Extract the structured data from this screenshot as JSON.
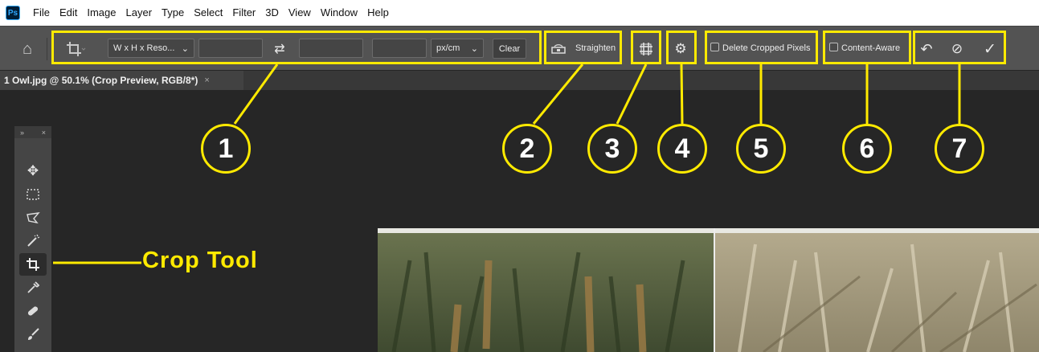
{
  "app": {
    "logo": "Ps",
    "menu": [
      "File",
      "Edit",
      "Image",
      "Layer",
      "Type",
      "Select",
      "Filter",
      "3D",
      "View",
      "Window",
      "Help"
    ]
  },
  "options": {
    "home_icon": "home-icon",
    "crop_icon": "crop-icon",
    "ratio_preset": "W x H x Reso...",
    "width_value": "",
    "swap_icon": "swap-arrows-icon",
    "height_value": "",
    "resolution_value": "",
    "resolution_unit": "px/cm",
    "clear_label": "Clear",
    "straighten_label": "Straighten",
    "overlay_icon": "grid-overlay-icon",
    "settings_icon": "gear-icon",
    "delete_cropped_label": "Delete Cropped Pixels",
    "content_aware_label": "Content-Aware",
    "reset_icon": "reset-icon",
    "cancel_icon": "cancel-icon",
    "commit_icon": "checkmark-icon"
  },
  "document": {
    "tab_title": "1 Owl.jpg @ 50.1% (Crop Preview, RGB/8*)",
    "close_glyph": "×"
  },
  "callouts": [
    "1",
    "2",
    "3",
    "4",
    "5",
    "6",
    "7"
  ],
  "crop_tool_label": "Crop Tool",
  "toolbar": {
    "header_left": "»",
    "header_right": "×",
    "tools": [
      "move-icon",
      "marquee-icon",
      "lasso-icon",
      "magic-wand-icon",
      "crop-icon",
      "eyedropper-icon",
      "healing-brush-icon",
      "brush-icon"
    ]
  },
  "colors": {
    "highlight": "#ffea00",
    "menubar": "#ffffff",
    "optionsbar": "#535353",
    "workspace": "#262626"
  }
}
